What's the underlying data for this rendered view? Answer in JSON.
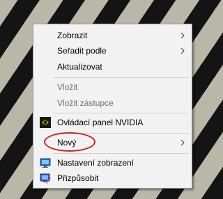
{
  "context_menu": {
    "items": [
      {
        "label": "Zobrazit",
        "submenu": true,
        "enabled": true
      },
      {
        "label": "Seřadit podle",
        "submenu": true,
        "enabled": true
      },
      {
        "label": "Aktualizovat",
        "submenu": false,
        "enabled": true
      },
      {
        "label": "Vložit",
        "submenu": false,
        "enabled": false
      },
      {
        "label": "Vložit zástupce",
        "submenu": false,
        "enabled": false
      },
      {
        "label": "Ovládací panel NVIDIA",
        "submenu": false,
        "enabled": true,
        "icon": "nvidia-icon"
      },
      {
        "label": "Nový",
        "submenu": true,
        "enabled": true,
        "highlighted": true
      },
      {
        "label": "Nastavení zobrazení",
        "submenu": false,
        "enabled": true,
        "icon": "display-icon"
      },
      {
        "label": "Přizpůsobit",
        "submenu": false,
        "enabled": true,
        "icon": "personalize-icon"
      }
    ]
  },
  "colors": {
    "highlight_circle": "#cc1f1f",
    "menu_background": "#f2f2f2",
    "disabled_text": "#6d6d6d",
    "nvidia_green": "#76b900"
  }
}
